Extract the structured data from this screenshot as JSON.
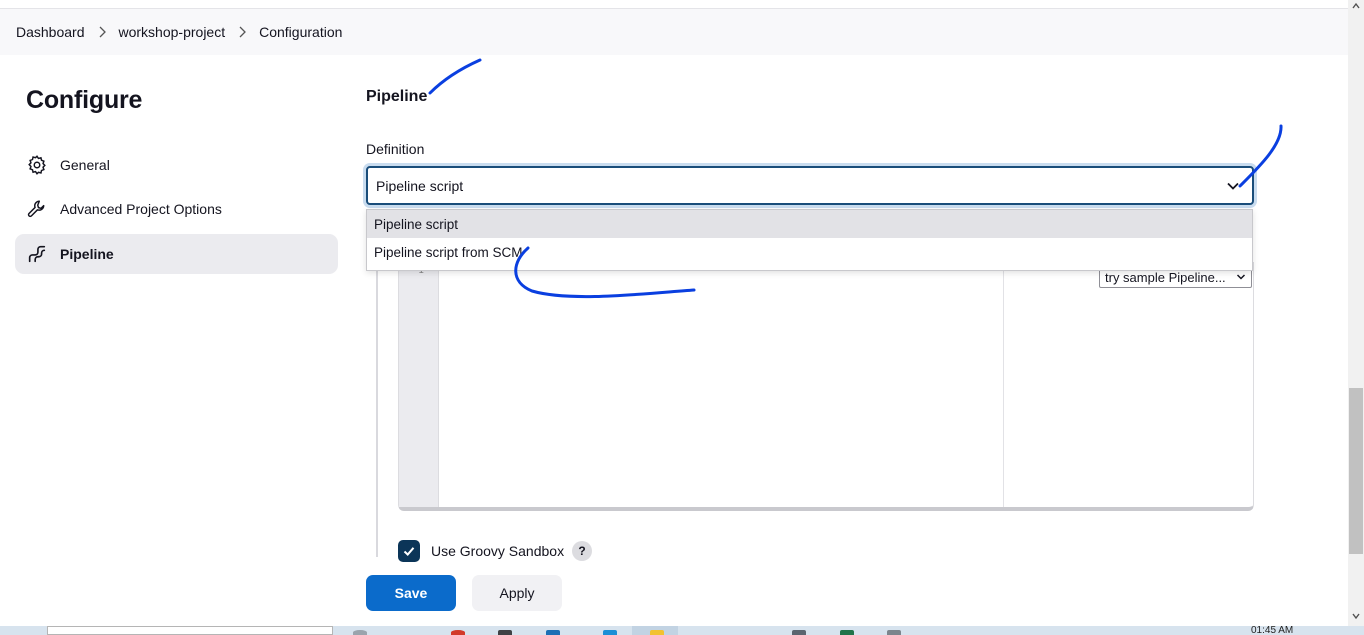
{
  "breadcrumb": {
    "items": [
      "Dashboard",
      "workshop-project",
      "Configuration"
    ]
  },
  "sidebar": {
    "title": "Configure",
    "items": [
      {
        "label": "General",
        "icon": "gear-icon"
      },
      {
        "label": "Advanced Project Options",
        "icon": "wrench-icon"
      },
      {
        "label": "Pipeline",
        "icon": "pipeline-icon",
        "active": true
      }
    ]
  },
  "main": {
    "section_title": "Pipeline",
    "definition_label": "Definition",
    "definition_value": "Pipeline script",
    "dropdown_options": [
      "Pipeline script",
      "Pipeline script from SCM"
    ],
    "editor": {
      "line_number": "1",
      "sample_select": "try sample Pipeline..."
    },
    "groovy_sandbox": {
      "label": "Use Groovy Sandbox",
      "checked": true,
      "help": "?"
    }
  },
  "buttons": {
    "save": "Save",
    "apply": "Apply"
  },
  "taskbar": {
    "clock": "01:45 AM"
  },
  "colors": {
    "primary_button": "#0b6bcb",
    "checkbox": "#0b3558",
    "annotation_ink": "#0a3fe0"
  }
}
